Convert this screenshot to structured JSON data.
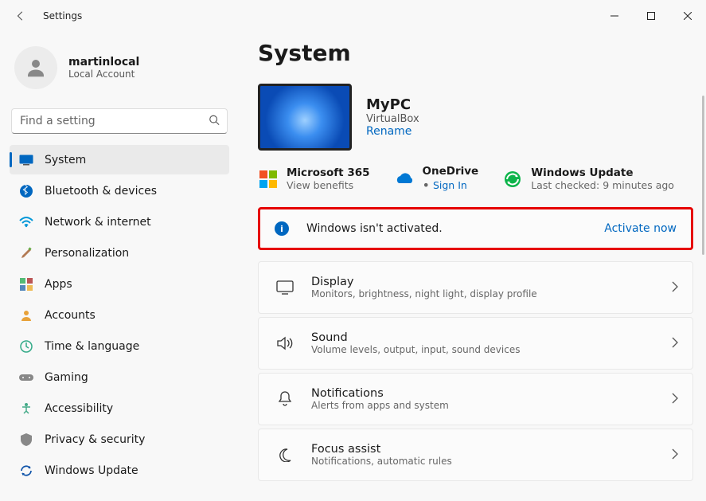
{
  "window": {
    "title": "Settings"
  },
  "profile": {
    "name": "martinlocal",
    "type": "Local Account"
  },
  "search": {
    "placeholder": "Find a setting"
  },
  "sidebar": {
    "items": [
      {
        "label": "System",
        "selected": true
      },
      {
        "label": "Bluetooth & devices"
      },
      {
        "label": "Network & internet"
      },
      {
        "label": "Personalization"
      },
      {
        "label": "Apps"
      },
      {
        "label": "Accounts"
      },
      {
        "label": "Time & language"
      },
      {
        "label": "Gaming"
      },
      {
        "label": "Accessibility"
      },
      {
        "label": "Privacy & security"
      },
      {
        "label": "Windows Update"
      }
    ]
  },
  "page": {
    "heading": "System",
    "pc": {
      "name": "MyPC",
      "subtitle": "VirtualBox",
      "rename": "Rename"
    },
    "tiles": {
      "m365": {
        "title": "Microsoft 365",
        "sub": "View benefits"
      },
      "onedrive": {
        "title": "OneDrive",
        "sub": "Sign In"
      },
      "update": {
        "title": "Windows Update",
        "sub": "Last checked: 9 minutes ago"
      }
    },
    "activation": {
      "text": "Windows isn't activated.",
      "action": "Activate now"
    },
    "cards": [
      {
        "title": "Display",
        "sub": "Monitors, brightness, night light, display profile"
      },
      {
        "title": "Sound",
        "sub": "Volume levels, output, input, sound devices"
      },
      {
        "title": "Notifications",
        "sub": "Alerts from apps and system"
      },
      {
        "title": "Focus assist",
        "sub": "Notifications, automatic rules"
      }
    ]
  }
}
